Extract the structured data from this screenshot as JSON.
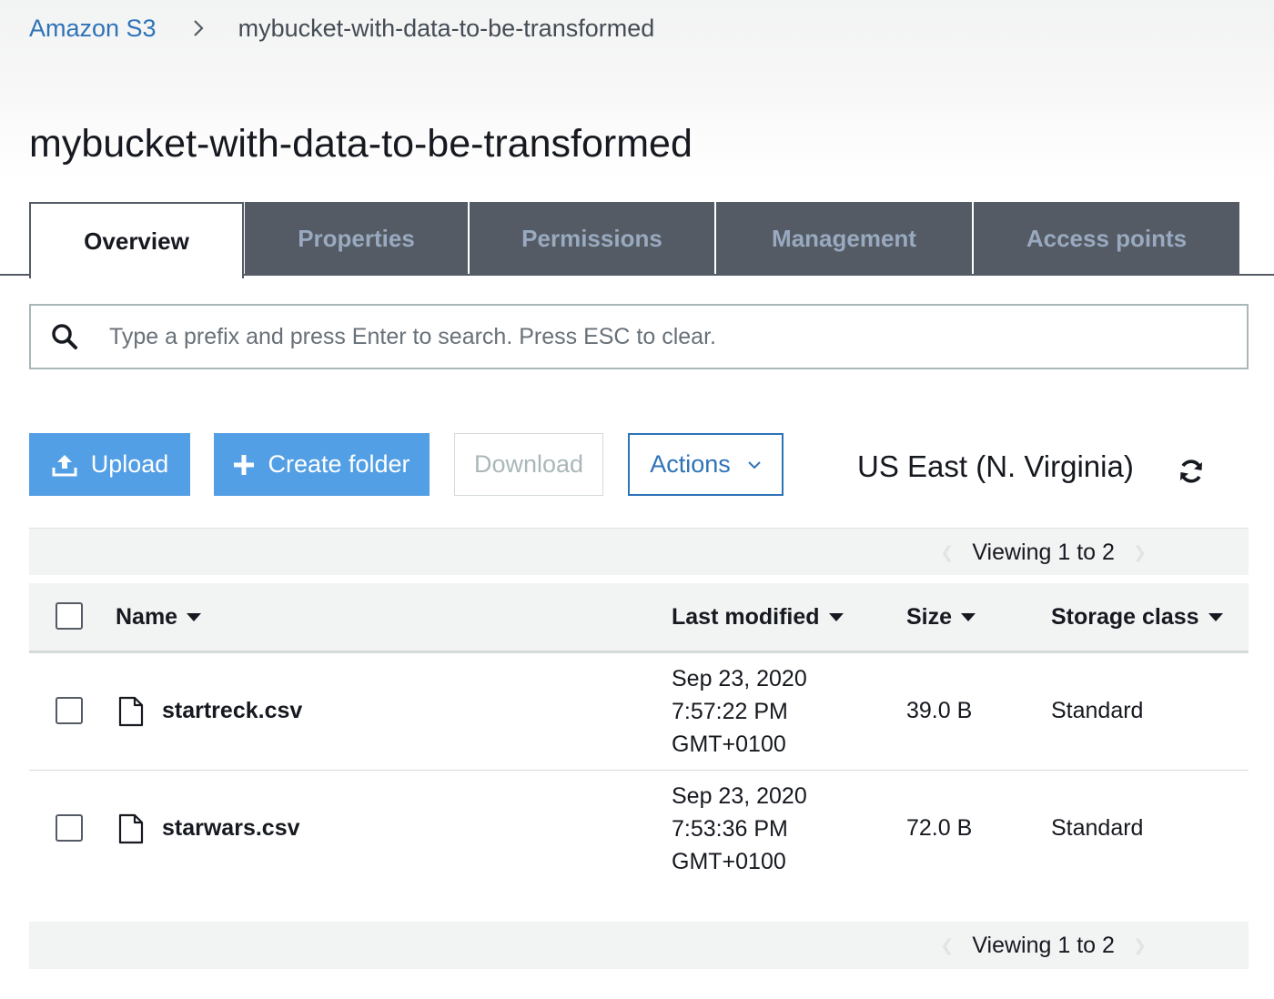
{
  "breadcrumb": {
    "root": "Amazon S3",
    "current": "mybucket-with-data-to-be-transformed"
  },
  "page_title": "mybucket-with-data-to-be-transformed",
  "tabs": [
    {
      "label": "Overview",
      "active": true
    },
    {
      "label": "Properties",
      "active": false
    },
    {
      "label": "Permissions",
      "active": false
    },
    {
      "label": "Management",
      "active": false
    },
    {
      "label": "Access points",
      "active": false
    }
  ],
  "search": {
    "placeholder": "Type a prefix and press Enter to search. Press ESC to clear.",
    "value": "",
    "icon": "search-icon"
  },
  "toolbar": {
    "upload_label": "Upload",
    "create_folder_label": "Create folder",
    "download_label": "Download",
    "actions_label": "Actions",
    "region": "US East (N. Virginia)",
    "refresh_icon": "refresh-icon"
  },
  "pager": {
    "top_text": "Viewing 1 to 2",
    "bottom_text": "Viewing 1 to 2"
  },
  "table": {
    "columns": [
      {
        "label": "Name"
      },
      {
        "label": "Last modified"
      },
      {
        "label": "Size"
      },
      {
        "label": "Storage class"
      }
    ],
    "rows": [
      {
        "name": "startreck.csv",
        "date": "Sep 23, 2020",
        "time": "7:57:22 PM",
        "tz": "GMT+0100",
        "size": "39.0 B",
        "storage_class": "Standard"
      },
      {
        "name": "starwars.csv",
        "date": "Sep 23, 2020",
        "time": "7:53:36 PM",
        "tz": "GMT+0100",
        "size": "72.0 B",
        "storage_class": "Standard"
      }
    ]
  },
  "colors": {
    "link": "#2e73b8",
    "primary_button": "#539fe5",
    "tab_inactive_bg": "#545b64",
    "tab_inactive_text": "#99a9bf"
  }
}
